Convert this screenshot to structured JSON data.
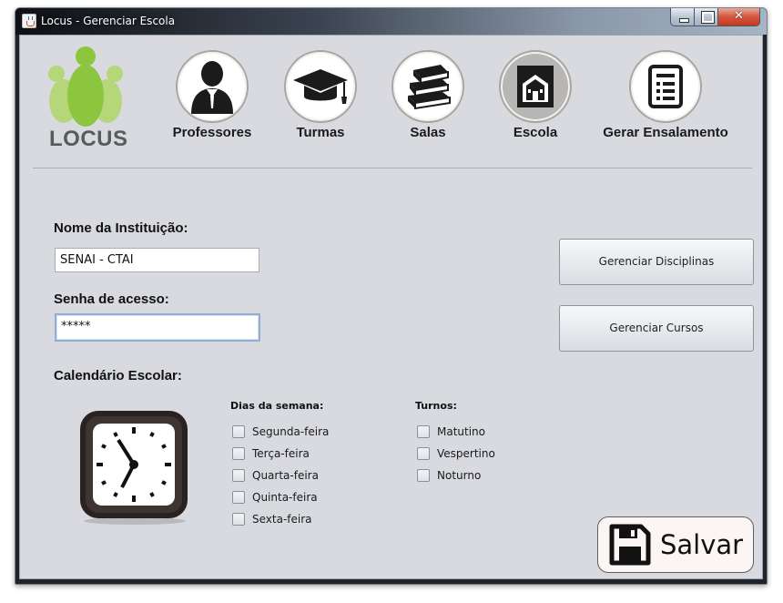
{
  "window": {
    "title": "Locus - Gerenciar Escola"
  },
  "logo": {
    "text": "LOCUS"
  },
  "nav": [
    {
      "label": "Professores",
      "icon": "professor-icon"
    },
    {
      "label": "Turmas",
      "icon": "graduation-cap-icon"
    },
    {
      "label": "Salas",
      "icon": "books-icon"
    },
    {
      "label": "Escola",
      "icon": "school-building-icon",
      "active": true
    },
    {
      "label": "Gerar Ensalamento",
      "icon": "document-list-icon"
    }
  ],
  "form": {
    "institution_label": "Nome da Instituição:",
    "institution_value": "SENAI - CTAI",
    "password_label": "Senha  de acesso:",
    "password_value": "*****",
    "calendar_label": "Calendário Escolar:"
  },
  "buttons": {
    "manage_disciplines": "Gerenciar Disciplinas",
    "manage_courses": "Gerenciar Cursos",
    "save": "Salvar"
  },
  "weekdays": {
    "title": "Dias da semana:",
    "items": [
      "Segunda-feira",
      "Terça-feira",
      "Quarta-feira",
      "Quinta-feira",
      "Sexta-feira"
    ]
  },
  "shifts": {
    "title": "Turnos:",
    "items": [
      "Matutino",
      "Vespertino",
      "Noturno"
    ]
  },
  "colors": {
    "logo_green": "#8cc63f",
    "logo_gray": "#585a5c",
    "window_bg": "#d8dae0"
  }
}
